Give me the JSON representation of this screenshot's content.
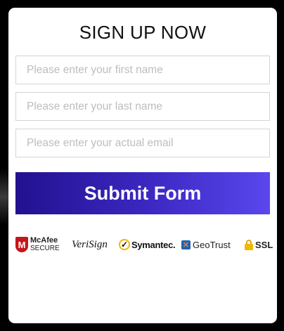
{
  "form": {
    "title": "SIGN UP NOW",
    "first_name_placeholder": "Please enter your first name",
    "last_name_placeholder": "Please enter your last name",
    "email_placeholder": "Please enter your actual email",
    "submit_label": "Submit Form"
  },
  "trust_badges": {
    "mcafee": {
      "icon": "mcafee-shield-icon",
      "glyph": "M",
      "line1": "McAfee",
      "line2": "SECURE"
    },
    "verisign": {
      "text": "VeriSign"
    },
    "symantec": {
      "icon": "check-circle-icon",
      "glyph": "✓",
      "text": "Symantec."
    },
    "geotrust": {
      "icon": "geotrust-icon",
      "glyph": "✕",
      "text": "GeoTrust"
    },
    "ssl": {
      "icon": "lock-icon",
      "text": "SSL"
    }
  },
  "colors": {
    "button_gradient_start": "#22118f",
    "button_gradient_end": "#5a47ee",
    "card_background": "#ffffff",
    "page_background": "#000000"
  }
}
